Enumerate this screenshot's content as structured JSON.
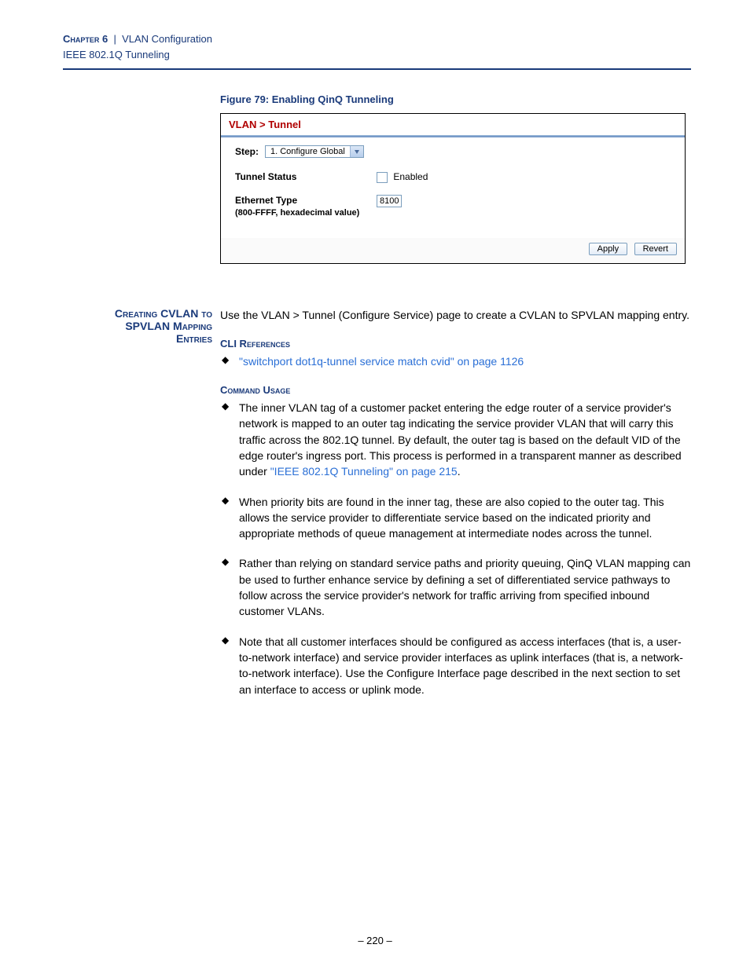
{
  "header": {
    "chapter_label": "Chapter 6",
    "separator": "|",
    "chapter_title": "VLAN Configuration",
    "subhead": "IEEE 802.1Q Tunneling"
  },
  "figure": {
    "caption": "Figure 79:  Enabling QinQ Tunneling"
  },
  "screenshot": {
    "breadcrumb_parent": "VLAN",
    "breadcrumb_child": "Tunnel",
    "step_label": "Step:",
    "step_value": "1. Configure Global",
    "tunnel_status_label": "Tunnel Status",
    "enabled_label": "Enabled",
    "ethertype_label": "Ethernet Type",
    "ethertype_sublabel": "(800-FFFF, hexadecimal value)",
    "ethertype_value": "8100",
    "apply": "Apply",
    "revert": "Revert"
  },
  "section": {
    "margin_head_line1": "Creating CVLAN to",
    "margin_head_line2": "SPVLAN Mapping",
    "margin_head_line3": "Entries",
    "intro": "Use the VLAN > Tunnel (Configure Service) page to create a CVLAN to SPVLAN mapping entry.",
    "cli_head": "CLI References",
    "cli_link": "\"switchport dot1q-tunnel service match cvid\" on page 1126",
    "usage_head": "Command Usage",
    "usage": {
      "b1a": "The inner VLAN tag of a customer packet entering the edge router of a service provider's network is mapped to an outer tag indicating the service provider VLAN that will carry this traffic across the 802.1Q tunnel. By default, the outer tag is based on the default VID of the edge router's ingress port. This process is performed in a transparent manner as described under ",
      "b1link": "\"IEEE 802.1Q Tunneling\" on page 215",
      "b1b": ".",
      "b2": "When priority bits are found in the inner tag, these are also copied to the outer tag. This allows the service provider to differentiate service based on the indicated priority and appropriate methods of queue management at intermediate nodes across the tunnel.",
      "b3": "Rather than relying on standard service paths and priority queuing, QinQ VLAN mapping can be used to further enhance service by defining a set of differentiated service pathways to follow across the service provider's network for traffic arriving from specified inbound customer VLANs.",
      "b4": "Note that all customer interfaces should be configured as access interfaces (that is, a user-to-network interface) and service provider interfaces as uplink interfaces (that is, a network-to-network interface). Use the Configure Interface page described in the next section to set an interface to access or uplink mode."
    }
  },
  "page_number": "–  220  –"
}
